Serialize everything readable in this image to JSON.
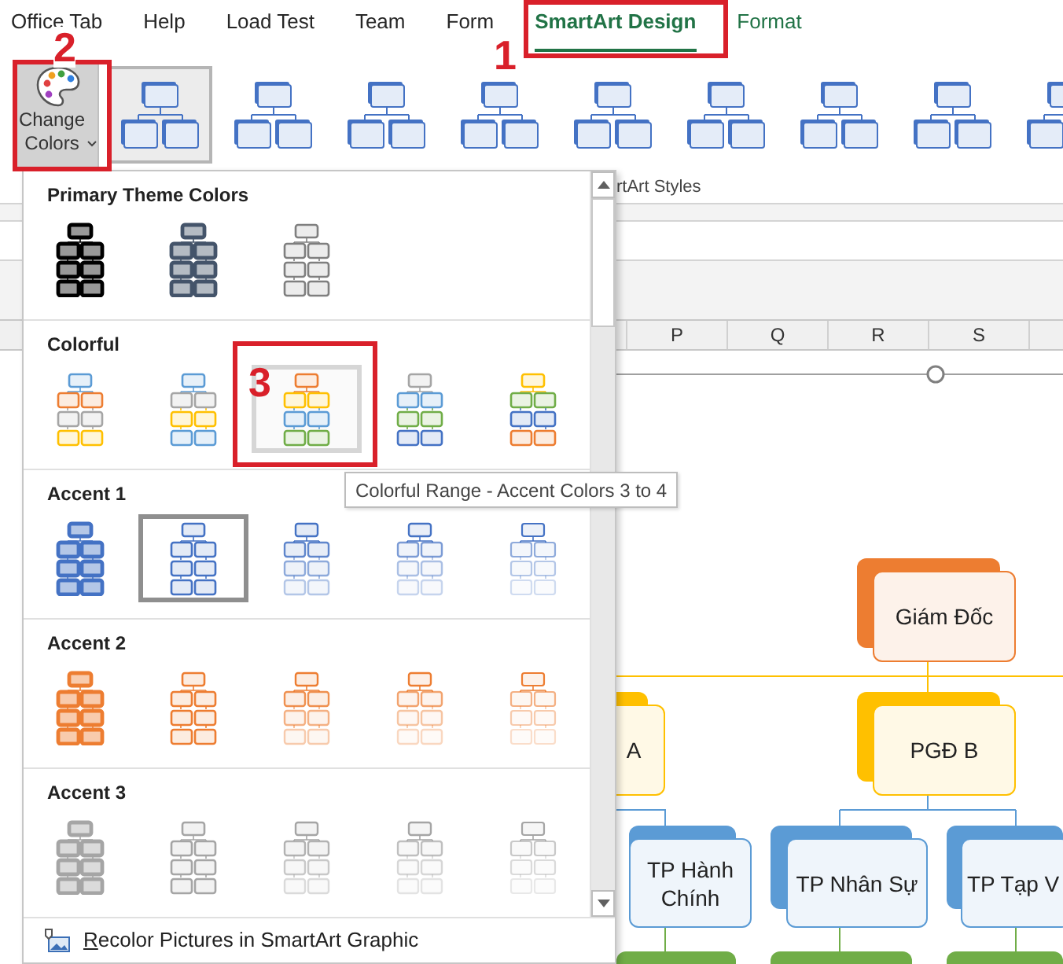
{
  "tabs": [
    {
      "label": "Office Tab",
      "selected": false,
      "kind": "standard"
    },
    {
      "label": "Help",
      "selected": false,
      "kind": "standard"
    },
    {
      "label": "Load Test",
      "selected": false,
      "kind": "standard"
    },
    {
      "label": "Team",
      "selected": false,
      "kind": "standard"
    },
    {
      "label": "Form",
      "selected": false,
      "kind": "standard"
    },
    {
      "label": "SmartArt Design",
      "selected": true,
      "kind": "contextual"
    },
    {
      "label": "Format",
      "selected": false,
      "kind": "contextual"
    }
  ],
  "change_colors_button": {
    "label": "Change Colors",
    "expanded": true
  },
  "style_gallery": {
    "group_label": "rtArt Styles",
    "items": [
      {
        "selected": true
      },
      {
        "selected": false
      },
      {
        "selected": false
      },
      {
        "selected": false
      },
      {
        "selected": false
      },
      {
        "selected": false
      },
      {
        "selected": false
      },
      {
        "selected": false
      },
      {
        "selected": false
      }
    ]
  },
  "change_colors_menu": {
    "sections": [
      {
        "title": "Primary Theme Colors",
        "options": [
          {
            "kind": "filled",
            "color": "#000000",
            "selected": false,
            "hovered": false
          },
          {
            "kind": "filled",
            "color": "#44546a",
            "selected": false,
            "hovered": false
          },
          {
            "kind": "outline",
            "color": "#7f7f7f",
            "selected": false,
            "hovered": false
          }
        ]
      },
      {
        "title": "Colorful",
        "options": [
          {
            "kind": "outline",
            "tiers": [
              {
                "color": "#5b9bd5"
              },
              {
                "color": "#ed7d31"
              },
              {
                "color": "#a5a5a5"
              },
              {
                "color": "#ffc000"
              }
            ],
            "selected": false,
            "hovered": false
          },
          {
            "kind": "outline",
            "tiers": [
              {
                "color": "#5b9bd5"
              },
              {
                "color": "#a5a5a5"
              },
              {
                "color": "#ffc000"
              },
              {
                "color": "#5b9bd5"
              }
            ],
            "selected": false,
            "hovered": false
          },
          {
            "kind": "outline",
            "tiers": [
              {
                "color": "#ed7d31"
              },
              {
                "color": "#ffc000"
              },
              {
                "color": "#5b9bd5"
              },
              {
                "color": "#70ad47"
              }
            ],
            "selected": false,
            "hovered": true
          },
          {
            "kind": "outline",
            "tiers": [
              {
                "color": "#a5a5a5"
              },
              {
                "color": "#5b9bd5"
              },
              {
                "color": "#70ad47"
              },
              {
                "color": "#4472c4"
              }
            ],
            "selected": false,
            "hovered": false
          },
          {
            "kind": "outline",
            "tiers": [
              {
                "color": "#ffc000"
              },
              {
                "color": "#70ad47"
              },
              {
                "color": "#4472c4"
              },
              {
                "color": "#ed7d31"
              }
            ],
            "selected": false,
            "hovered": false
          }
        ]
      },
      {
        "title": "Accent 1",
        "options": [
          {
            "kind": "filled",
            "color": "#4472c4",
            "selected": false,
            "hovered": false
          },
          {
            "kind": "outline",
            "color": "#4472c4",
            "selected": true,
            "hovered": false
          },
          {
            "kind": "fade",
            "color": "#4472c4",
            "selected": false,
            "hovered": false
          },
          {
            "kind": "fade2",
            "color": "#4472c4",
            "selected": false,
            "hovered": false
          },
          {
            "kind": "fade3",
            "color": "#4472c4",
            "selected": false,
            "hovered": false
          }
        ]
      },
      {
        "title": "Accent 2",
        "options": [
          {
            "kind": "filled",
            "color": "#ed7d31",
            "selected": false,
            "hovered": false
          },
          {
            "kind": "outline",
            "color": "#ed7d31",
            "selected": false,
            "hovered": false
          },
          {
            "kind": "fade",
            "color": "#ed7d31",
            "selected": false,
            "hovered": false
          },
          {
            "kind": "fade2",
            "color": "#ed7d31",
            "selected": false,
            "hovered": false
          },
          {
            "kind": "fade3",
            "color": "#ed7d31",
            "selected": false,
            "hovered": false
          }
        ]
      },
      {
        "title": "Accent 3",
        "options": [
          {
            "kind": "filled",
            "color": "#a5a5a5",
            "selected": false,
            "hovered": false
          },
          {
            "kind": "outline",
            "color": "#a5a5a5",
            "selected": false,
            "hovered": false
          },
          {
            "kind": "fade",
            "color": "#a5a5a5",
            "selected": false,
            "hovered": false
          },
          {
            "kind": "fade2",
            "color": "#a5a5a5",
            "selected": false,
            "hovered": false
          },
          {
            "kind": "fade3",
            "color": "#a5a5a5",
            "selected": false,
            "hovered": false
          }
        ]
      }
    ],
    "recolor_option": "Recolor Pictures in SmartArt Graphic"
  },
  "tooltip": "Colorful Range - Accent Colors 3 to 4",
  "column_headers": [
    "P",
    "Q",
    "R",
    "S"
  ],
  "org_chart": {
    "nodes": [
      {
        "text": "Giám Đốc",
        "color": "#ed7d31",
        "children": [
          {
            "text": "A",
            "color": "#ffc000",
            "children": [
              {
                "text": "TP Hành Chính",
                "color": "#5b9bd5"
              }
            ]
          },
          {
            "text": "PGĐ B",
            "color": "#ffc000",
            "children": [
              {
                "text": "TP Nhân Sự",
                "color": "#5b9bd5"
              },
              {
                "text": "TP Tạp V",
                "color": "#5b9bd5"
              }
            ]
          }
        ]
      }
    ]
  },
  "annotations": [
    {
      "label": "1"
    },
    {
      "label": "2"
    },
    {
      "label": "3"
    }
  ]
}
